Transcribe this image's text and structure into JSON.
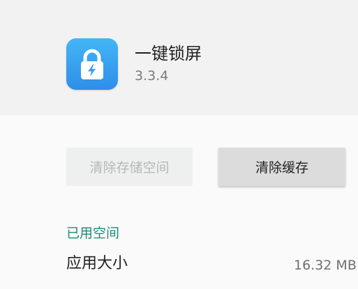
{
  "app": {
    "name": "一键锁屏",
    "version": "3.3.4",
    "icon": "lock-bolt-icon",
    "icon_color": "#3aa3f1"
  },
  "actions": {
    "clear_storage_label": "清除存储空间",
    "clear_cache_label": "清除缓存"
  },
  "storage": {
    "section_title": "已用空间",
    "rows": [
      {
        "label": "应用大小",
        "value": "16.32 MB"
      }
    ]
  },
  "colors": {
    "accent": "#1e8a78",
    "header_bg": "#f2f2f2",
    "page_bg": "#fafafa"
  }
}
